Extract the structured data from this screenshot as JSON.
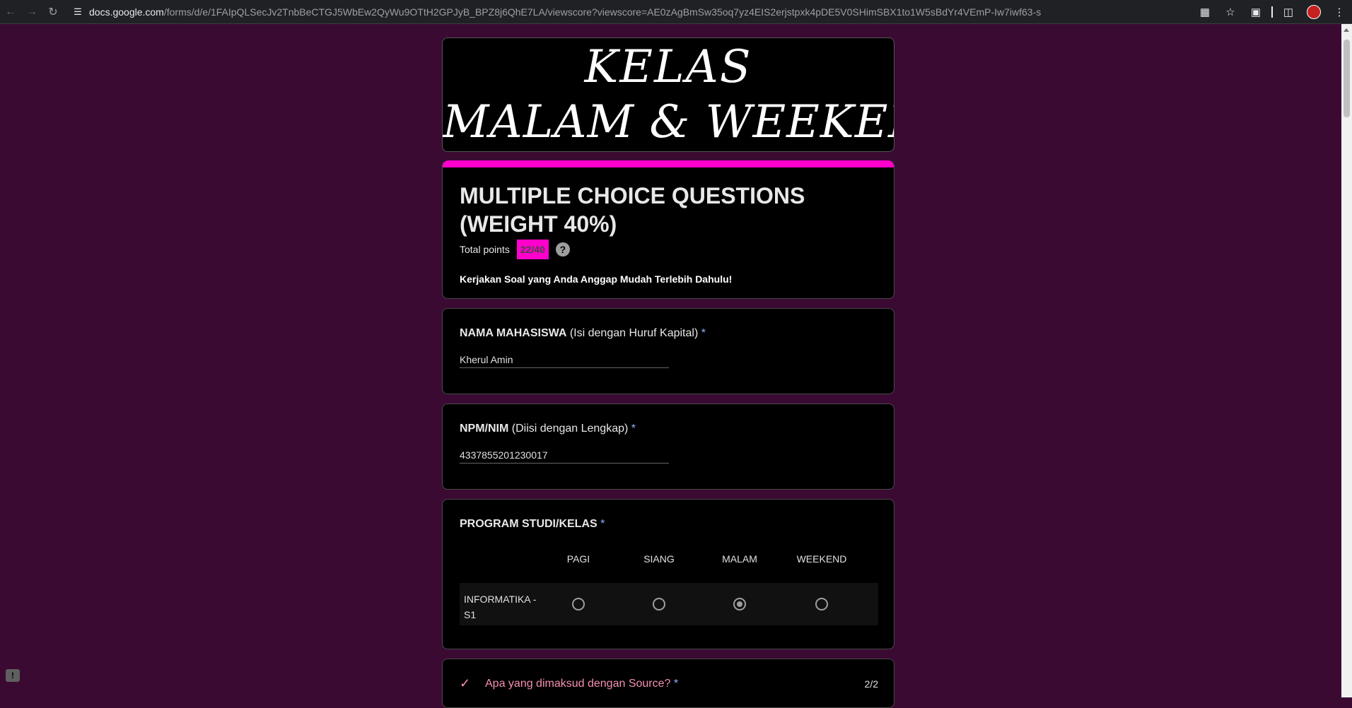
{
  "browser": {
    "url_host": "docs.google.com",
    "url_path": "/forms/d/e/1FAIpQLSecJv2TnbBeCTGJ5WbEw2QyWu9OTtH2GPJyB_BPZ8j6QhE7LA/viewscore?viewscore=AE0zAgBmSw35oq7yz4EIS2erjstpxk4pDE5V0SHimSBX1to1W5sBdYr4VEmP-Iw7iwf63-s"
  },
  "banner": {
    "line1": "KELAS",
    "line2": "MALAM & WEEKEND"
  },
  "header": {
    "title": "MULTIPLE CHOICE QUESTIONS (WEIGHT 40%)",
    "total_points_label": "Total points",
    "score": "22/40",
    "help": "?",
    "description": "Kerjakan Soal yang Anda Anggap Mudah Terlebih Dahulu!"
  },
  "q_name": {
    "title_bold": "NAMA MAHASISWA",
    "title_rest": " (Isi dengan Huruf Kapital)",
    "required": " *",
    "answer": "Kherul Amin"
  },
  "q_npm": {
    "title_bold": "NPM/NIM",
    "title_rest": " (Diisi dengan Lengkap)",
    "required": " *",
    "answer": "4337855201230017"
  },
  "q_prodi": {
    "title_bold": "PROGRAM STUDI/KELAS",
    "required": " *",
    "columns": [
      "PAGI",
      "SIANG",
      "MALAM",
      "WEEKEND"
    ],
    "row_label": "INFORMATIKA - S1",
    "selected": "MALAM"
  },
  "q_source": {
    "title": "Apa yang dimaksud dengan Source?",
    "required": " *",
    "score": "2/2"
  },
  "colors": {
    "page_bg": "#3a0a33",
    "accent": "#ff00cc",
    "correct": "#f48fb1"
  }
}
